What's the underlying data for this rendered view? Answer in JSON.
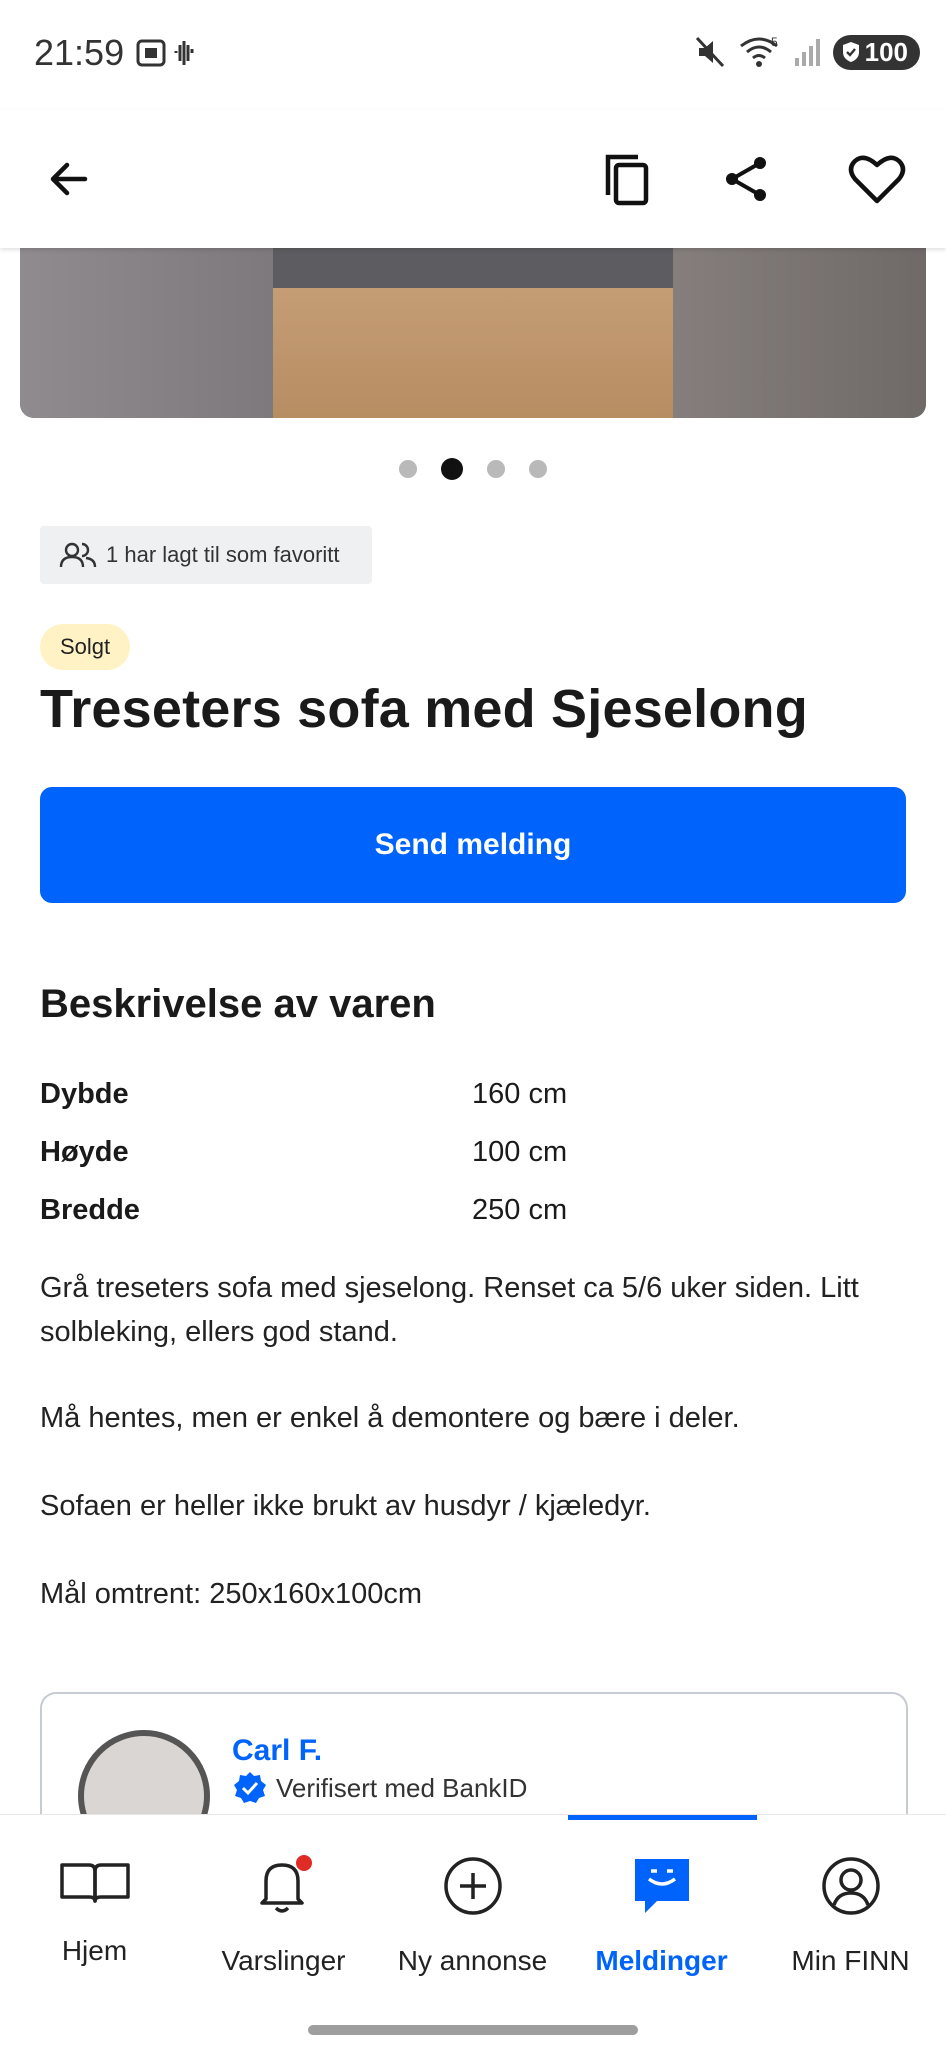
{
  "status_bar": {
    "time": "21:59",
    "battery": "100",
    "wifi_badge": "5"
  },
  "top_bar": {
    "back_icon": "arrow-left-icon",
    "copy_icon": "copy-icon",
    "share_icon": "share-icon",
    "favorite_icon": "heart-icon"
  },
  "gallery": {
    "total_images": 4,
    "active_index": 1
  },
  "listing": {
    "favorites_text": "1 har lagt til som favoritt",
    "status_badge": "Solgt",
    "title": "Treseters sofa med Sjeselong",
    "send_button": "Send melding"
  },
  "description": {
    "heading": "Beskrivelse av varen",
    "specs": [
      {
        "label": "Dybde",
        "value": "160 cm"
      },
      {
        "label": "Høyde",
        "value": "100 cm"
      },
      {
        "label": "Bredde",
        "value": "250 cm"
      }
    ],
    "paragraphs": [
      "Grå treseters sofa med sjeselong. Renset ca 5/6 uker siden. Litt solbleking, ellers god stand.",
      "Må hentes, men er enkel å demontere og bære i deler.",
      "Sofaen er heller ikke brukt av husdyr / kjæledyr.",
      "Mål omtrent: 250x160x100cm"
    ]
  },
  "seller": {
    "name": "Carl F.",
    "verified_text": "Verifisert med BankID"
  },
  "bottom_nav": {
    "items": [
      {
        "label": "Hjem",
        "icon": "book-icon"
      },
      {
        "label": "Varslinger",
        "icon": "bell-icon"
      },
      {
        "label": "Ny annonse",
        "icon": "plus-circle-icon"
      },
      {
        "label": "Meldinger",
        "icon": "chat-icon"
      },
      {
        "label": "Min FINN",
        "icon": "profile-icon"
      }
    ],
    "active": "Meldinger"
  },
  "colors": {
    "accent": "#0063fb",
    "badge_bg": "#fff3c5",
    "notification_dot": "#e02b27"
  }
}
